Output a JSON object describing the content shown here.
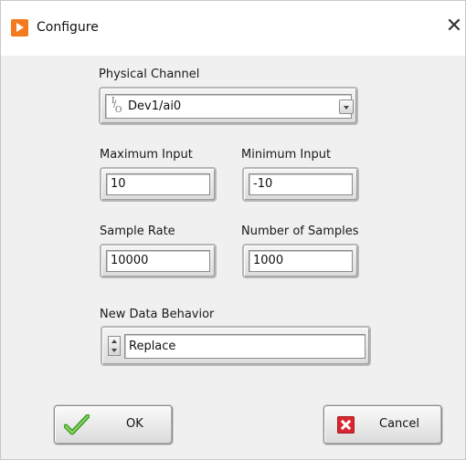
{
  "window": {
    "title": "Configure",
    "close_glyph": "✕"
  },
  "physical_channel": {
    "label": "Physical Channel",
    "value": "Dev1/ai0",
    "io_icon": {
      "top": "I",
      "slash": "/",
      "bottom": "O"
    }
  },
  "maximum_input": {
    "label": "Maximum Input",
    "value": "10"
  },
  "minimum_input": {
    "label": "Minimum Input",
    "value": "-10"
  },
  "sample_rate": {
    "label": "Sample Rate",
    "value": "10000"
  },
  "number_of_samples": {
    "label": "Number of Samples",
    "value": "1000"
  },
  "new_data_behavior": {
    "label": "New Data Behavior",
    "value": "Replace"
  },
  "buttons": {
    "ok_label": "OK",
    "cancel_label": "Cancel"
  },
  "icons": {
    "app": "labview-run-arrow-icon",
    "close": "close-icon",
    "dropdown": "chevron-down-icon",
    "ring": "up-down-arrows-icon",
    "ok": "green-checkmark-icon",
    "cancel": "red-x-icon"
  },
  "colors": {
    "app_icon": "#f47a20",
    "ok_check": "#4caf2a",
    "cancel_icon": "#d9262e",
    "dialog_background": "#f0f0f0"
  }
}
